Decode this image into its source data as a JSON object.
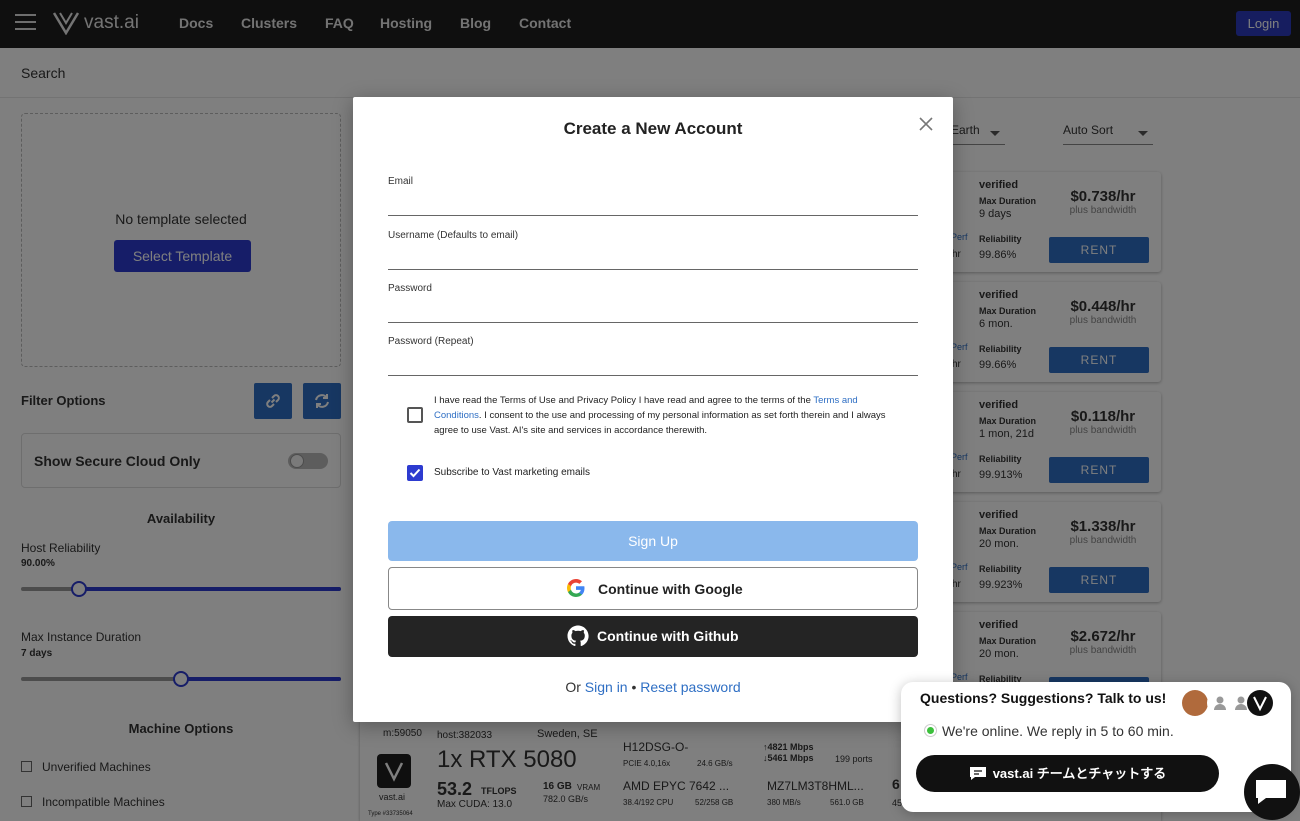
{
  "header": {
    "brand": "vast.ai",
    "nav": [
      "Docs",
      "Clusters",
      "FAQ",
      "Hosting",
      "Blog",
      "Contact"
    ],
    "login": "Login"
  },
  "search": {
    "label": "Search"
  },
  "template": {
    "none": "No template selected",
    "select": "Select Template"
  },
  "filters": {
    "title": "Filter Options",
    "secure": "Show Secure Cloud Only",
    "availability": "Availability",
    "reliability_label": "Host Reliability",
    "reliability_value": "90.00%",
    "reliability_fraction": 0.18,
    "duration_label": "Max Instance Duration",
    "duration_value": "7 days",
    "duration_fraction": 0.5,
    "machine_options": "Machine Options",
    "unverified": "Unverified Machines",
    "incompatible": "Incompatible Machines"
  },
  "sort": {
    "region": "Earth",
    "order": "Auto Sort"
  },
  "listings": [
    {
      "verified": "verified",
      "md_label": "Max Duration",
      "duration": "9 days",
      "rel_label": "Reliability",
      "reliability": "99.86%",
      "price": "$0.738/hr",
      "bandwidth": "plus bandwidth",
      "rent": "RENT",
      "perf": "Perf",
      "hr": "hr"
    },
    {
      "verified": "verified",
      "md_label": "Max Duration",
      "duration": "6 mon.",
      "rel_label": "Reliability",
      "reliability": "99.66%",
      "price": "$0.448/hr",
      "bandwidth": "plus bandwidth",
      "rent": "RENT",
      "perf": "Perf",
      "hr": "hr"
    },
    {
      "verified": "verified",
      "md_label": "Max Duration",
      "duration": "1 mon, 21d",
      "rel_label": "Reliability",
      "reliability": "99.913%",
      "price": "$0.118/hr",
      "bandwidth": "plus bandwidth",
      "rent": "RENT",
      "perf": "Perf",
      "hr": "hr"
    },
    {
      "verified": "verified",
      "md_label": "Max Duration",
      "duration": "20 mon.",
      "rel_label": "Reliability",
      "reliability": "99.923%",
      "price": "$1.338/hr",
      "bandwidth": "plus bandwidth",
      "rent": "RENT",
      "perf": "Perf",
      "hr": "hr"
    },
    {
      "verified": "verified",
      "md_label": "Max Duration",
      "duration": "20 mon.",
      "rel_label": "Reliability",
      "reliability": "",
      "price": "$2.672/hr",
      "bandwidth": "plus bandwidth",
      "rent": "RENT",
      "perf": "Perf",
      "hr": ""
    }
  ],
  "bottom_listing": {
    "id": "m:59050",
    "host": "host:382033",
    "location": "Sweden, SE",
    "brand": "vast.ai",
    "type": "Type #33735064",
    "gpu": "1x RTX 5080",
    "tflops": "53.2",
    "tflops_unit": "TFLOPS",
    "cuda": "Max CUDA: 13.0",
    "vram": "16 GB",
    "vram_unit": "VRAM",
    "vram_bw": "782.0 GB/s",
    "mobo": "H12DSG-O-",
    "pcie": "PCIE 4.0,16x",
    "pcie_bw": "24.6 GB/s",
    "cpu": "AMD EPYC 7642 ...",
    "cpu_cores": "38.4/192 CPU",
    "ram": "52/258 GB",
    "up": "↑4821 Mbps",
    "down": "↓5461 Mbps",
    "ports": "199 ports",
    "disk": "MZ7LM3T8HML...",
    "disk_bw": "380 MB/s",
    "disk_size": "561.0 GB",
    "partial1": "6",
    "partial2": "453."
  },
  "modal": {
    "title": "Create a New Account",
    "email": "Email",
    "username": "Username (Defaults to email)",
    "password": "Password",
    "password_repeat": "Password (Repeat)",
    "terms_pre": "I have read the Terms of Use and Privacy Policy I have read and agree to the terms of the ",
    "terms_link": "Terms and Conditions",
    "terms_post": ".  I consent to the use and processing of my personal information as set forth therein and I always agree to use Vast. AI's site and services in accordance therewith.",
    "subscribe": "Subscribe to Vast marketing emails",
    "signup": "Sign Up",
    "google": "Continue with Google",
    "github": "Continue with Github",
    "or": "Or",
    "signin": "Sign in",
    "sep": "•",
    "reset": "Reset password"
  },
  "chat": {
    "question": "Questions? Suggestions? Talk to us!",
    "online": "We're online. We reply in 5 to 60 min.",
    "cta_brand": "vast.ai",
    "cta_text": " チームとチャットする"
  },
  "colors": {
    "primary": "#2d3bd0",
    "rent": "#2f6fc4",
    "signup_disabled": "#8ab8ec",
    "online": "#3cc03c"
  }
}
